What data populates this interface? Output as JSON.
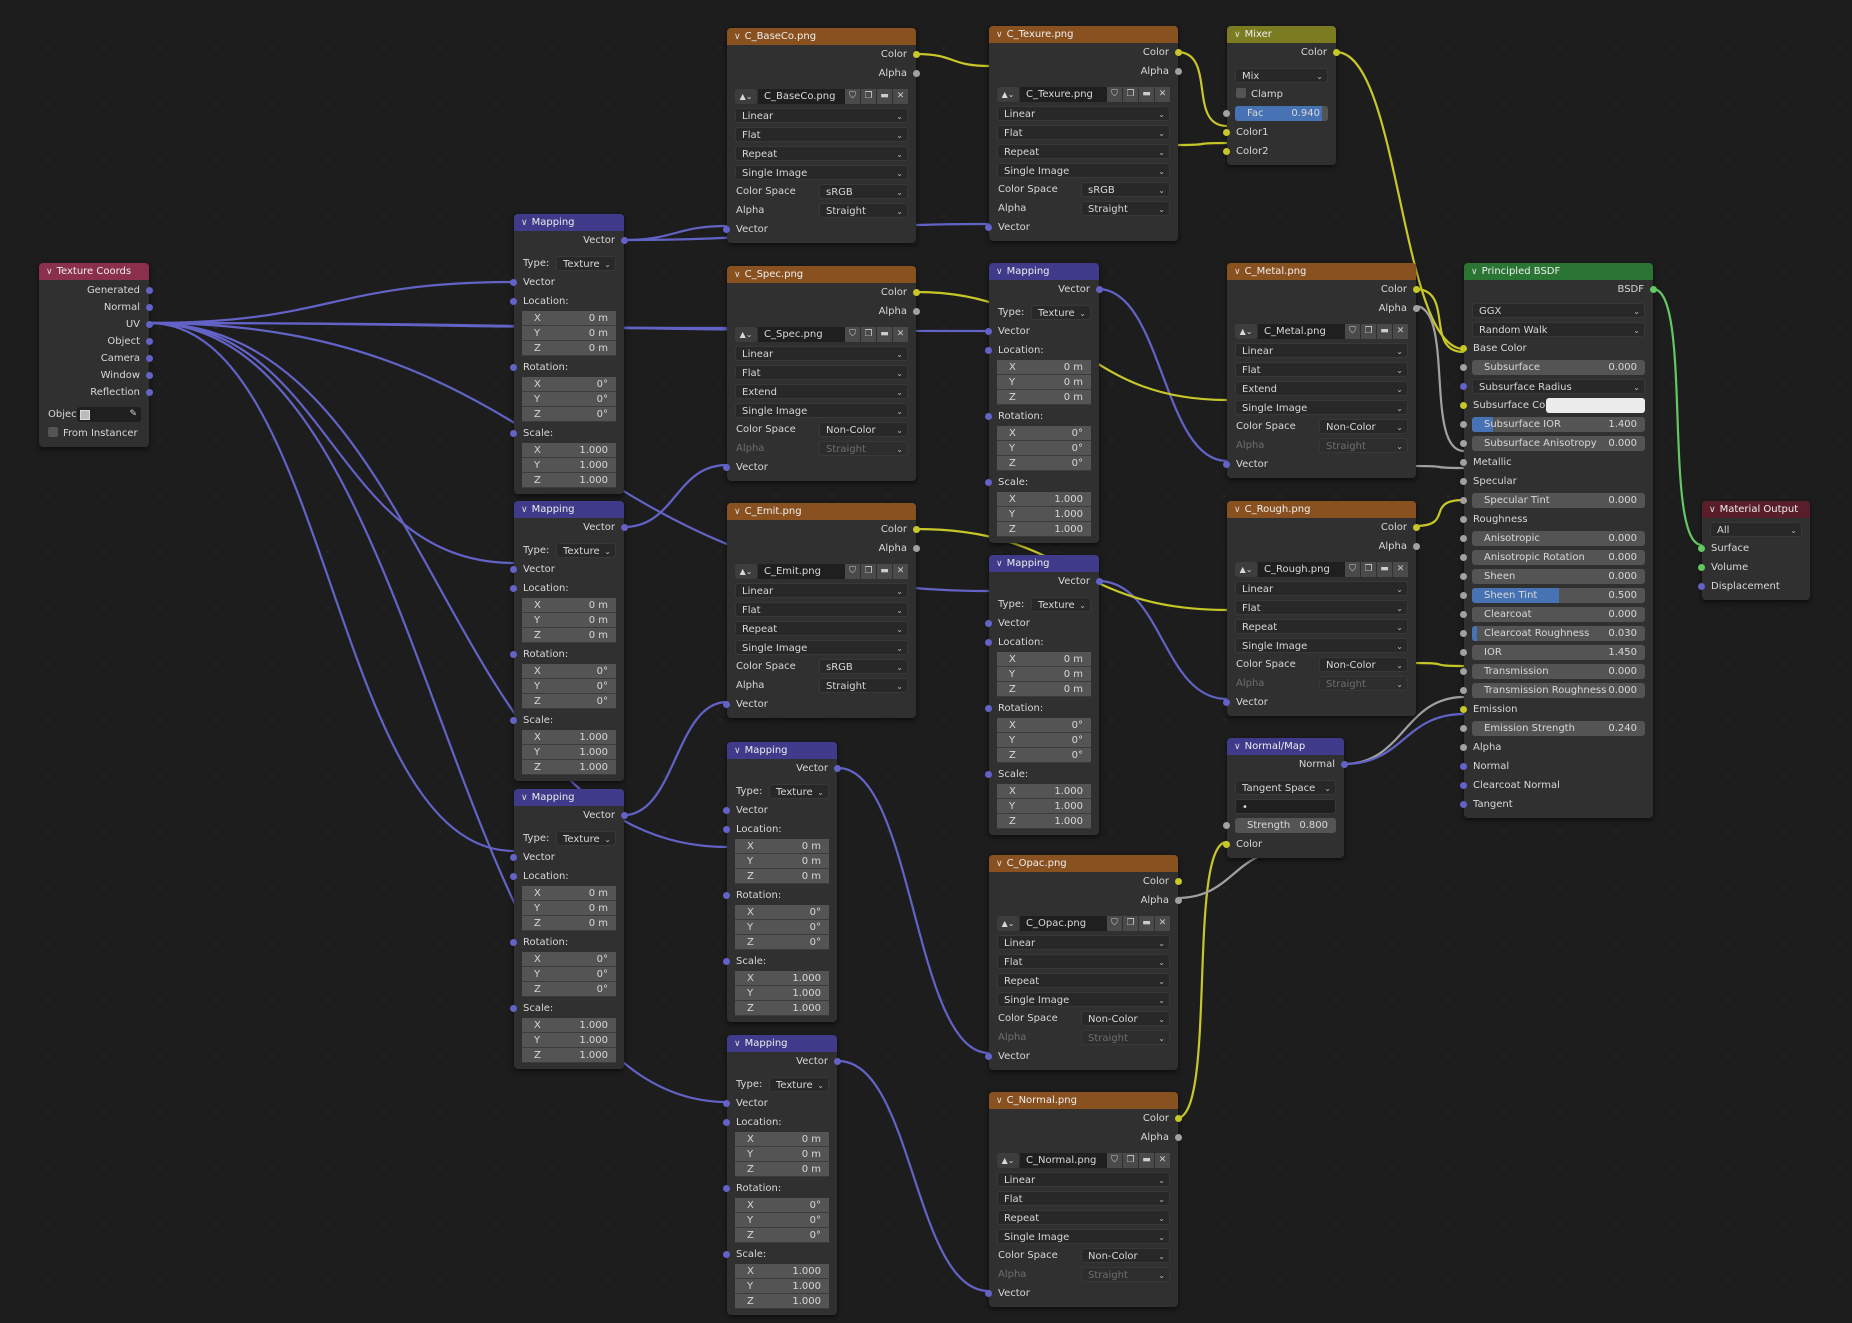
{
  "colors": {
    "vector_socket": "#6363c7",
    "color_socket": "#c7c729",
    "float_socket": "#a1a1a1",
    "shader_socket": "#63c763",
    "texture_header": "#8a5120",
    "vector_header": "#3f3a8a",
    "input_header": "#8a2f4c",
    "mix_header": "#7b7b22",
    "shader_header": "#2b7534",
    "output_header": "#5a1e2a",
    "active_slider": "#4772b3"
  },
  "texcoords": {
    "title": "Texture Coords",
    "outputs": [
      "Generated",
      "Normal",
      "UV",
      "Object",
      "Camera",
      "Window",
      "Reflection"
    ],
    "object_label": "Object:",
    "from_instancer": "From Instancer"
  },
  "mapping": {
    "title": "Mapping",
    "out": "Vector",
    "type_label": "Type:",
    "type_value": "Texture",
    "in_vector": "Vector",
    "location": "Location:",
    "rotation": "Rotation:",
    "scale": "Scale:",
    "x": "X",
    "y": "Y",
    "z": "Z",
    "loc_val": "0 m",
    "rot_val": "0°",
    "scale_val": "1.000"
  },
  "image_common": {
    "color": "Color",
    "alpha": "Alpha",
    "interp": "Linear",
    "proj": "Flat",
    "colorspace_label": "Color Space",
    "alpha_label": "Alpha",
    "alpha_value": "Straight",
    "source": "Single Image",
    "vector": "Vector"
  },
  "images": {
    "baseco": {
      "title": "C_BaseCo.png",
      "file": "C_BaseCo.png",
      "ext": "Repeat",
      "cs": "sRGB"
    },
    "texure": {
      "title": "C_Texure.png",
      "file": "C_Texure.png",
      "ext": "Repeat",
      "cs": "sRGB"
    },
    "spec": {
      "title": "C_Spec.png",
      "file": "C_Spec.png",
      "ext": "Extend",
      "cs": "Non-Color"
    },
    "emit": {
      "title": "C_Emit.png",
      "file": "C_Emit.png",
      "ext": "Repeat",
      "cs": "sRGB"
    },
    "metal": {
      "title": "C_Metal.png",
      "file": "C_Metal.png",
      "ext": "Extend",
      "cs": "Non-Color"
    },
    "rough": {
      "title": "C_Rough.png",
      "file": "C_Rough.png",
      "ext": "Repeat",
      "cs": "Non-Color"
    },
    "opac": {
      "title": "C_Opac.png",
      "file": "C_Opac.png",
      "ext": "Repeat",
      "cs": "Non-Color"
    },
    "normal": {
      "title": "C_Normal.png",
      "file": "C_Normal.png",
      "ext": "Repeat",
      "cs": "Non-Color"
    }
  },
  "mixer": {
    "title": "Mixer",
    "out": "Color",
    "mode": "Mix",
    "clamp": "Clamp",
    "fac_label": "Fac",
    "fac_value": "0.940",
    "fac": 0.94,
    "color1": "Color1",
    "color2": "Color2"
  },
  "normalmap": {
    "title": "Normal/Map",
    "out": "Normal",
    "space": "Tangent Space",
    "uvmap": "•",
    "strength_label": "Strength",
    "strength_value": "0.800",
    "color": "Color"
  },
  "bsdf": {
    "title": "Principled BSDF",
    "out": "BSDF",
    "distribution": "GGX",
    "subsurface_method": "Random Walk",
    "base_color": "Base Color",
    "subsurface": "Subsurface",
    "subsurface_value": "0.000",
    "subsurface_radius": "Subsurface Radius",
    "subsurface_color": "Subsurface Co…",
    "subsurface_ior": "Subsurface IOR",
    "subsurface_ior_value": "1.400",
    "subsurface_aniso": "Subsurface Anisotropy",
    "subsurface_aniso_value": "0.000",
    "metallic": "Metallic",
    "specular": "Specular",
    "specular_tint": "Specular Tint",
    "specular_tint_value": "0.000",
    "roughness": "Roughness",
    "anisotropic": "Anisotropic",
    "anisotropic_value": "0.000",
    "aniso_rot": "Anisotropic Rotation",
    "aniso_rot_value": "0.000",
    "sheen": "Sheen",
    "sheen_value": "0.000",
    "sheen_tint": "Sheen Tint",
    "sheen_tint_value": "0.500",
    "clearcoat": "Clearcoat",
    "clearcoat_value": "0.000",
    "clearcoat_rough": "Clearcoat Roughness",
    "clearcoat_rough_value": "0.030",
    "ior": "IOR",
    "ior_value": "1.450",
    "transmission": "Transmission",
    "transmission_value": "0.000",
    "trans_rough": "Transmission Roughness",
    "trans_rough_value": "0.000",
    "emission": "Emission",
    "emission_strength": "Emission Strength",
    "emission_strength_value": "0.240",
    "alpha": "Alpha",
    "normal": "Normal",
    "clearcoat_normal": "Clearcoat Normal",
    "tangent": "Tangent"
  },
  "matout": {
    "title": "Material Output",
    "target": "All",
    "surface": "Surface",
    "volume": "Volume",
    "displacement": "Displacement"
  }
}
